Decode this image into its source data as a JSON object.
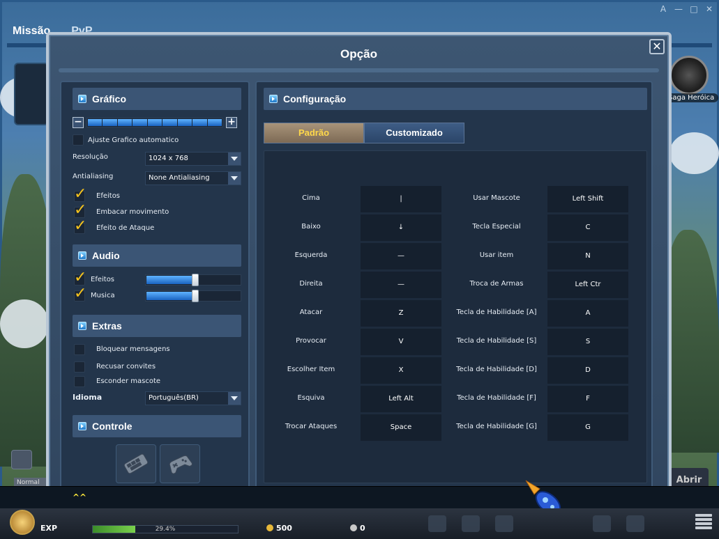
{
  "window_controls": [
    "A",
    "—",
    "□",
    "✕"
  ],
  "background": {
    "tabs": [
      "Missão",
      "PvP"
    ],
    "hero_label": "Saga Heróica",
    "normal_tag": "Normal",
    "open_button": "Abrir"
  },
  "modal": {
    "title": "Opção",
    "close_label": "✕"
  },
  "graphics": {
    "header": "Gráfico",
    "quality_level": 1.0,
    "auto_adjust_label": "Ajuste Grafico automatico",
    "auto_adjust_checked": false,
    "resolution_label": "Resolução",
    "resolution_value": "1024 x 768",
    "antialiasing_label": "Antialiasing",
    "antialiasing_value": "None Antialiasing",
    "effects_label": "Efeitos",
    "effects_checked": true,
    "motion_blur_label": "Embacar movimento",
    "motion_blur_checked": true,
    "attack_effect_label": "Efeito de Ataque",
    "attack_effect_checked": true
  },
  "audio": {
    "header": "Audio",
    "effects_label": "Efeitos",
    "effects_checked": true,
    "effects_level": 0.53,
    "music_label": "Musica",
    "music_checked": true,
    "music_level": 0.53
  },
  "extras": {
    "header": "Extras",
    "block_messages_label": "Bloquear mensagens",
    "refuse_invites_label": "Recusar convites",
    "hide_pet_label": "Esconder mascote",
    "language_label": "Idioma",
    "language_value": "Português(BR)"
  },
  "control": {
    "header": "Controle",
    "keyboard_icon": "keyboard-icon",
    "gamepad_icon": "gamepad-icon"
  },
  "config": {
    "header": "Configuração",
    "tabs": [
      {
        "label": "Padrão",
        "active": true
      },
      {
        "label": "Customizado",
        "active": false
      }
    ],
    "left_keys": [
      {
        "action": "Cima",
        "key": "|"
      },
      {
        "action": "Baixo",
        "key": "↓"
      },
      {
        "action": "Esquerda",
        "key": "—"
      },
      {
        "action": "Direita",
        "key": "—"
      },
      {
        "action": "Atacar",
        "key": "Z"
      },
      {
        "action": "Provocar",
        "key": "V"
      },
      {
        "action": "Escolher Item",
        "key": "X"
      },
      {
        "action": "Esquiva",
        "key": "Left Alt"
      },
      {
        "action": "Trocar Ataques",
        "key": "Space"
      }
    ],
    "right_keys": [
      {
        "action": "Usar Mascote",
        "key": "Left Shift"
      },
      {
        "action": "Tecla Especial",
        "key": "C"
      },
      {
        "action": "Usar item",
        "key": "N"
      },
      {
        "action": "Troca de Armas",
        "key": "Left Ctr"
      },
      {
        "action": "Tecla de Habilidade [A]",
        "key": "A"
      },
      {
        "action": "Tecla de Habilidade [S]",
        "key": "S"
      },
      {
        "action": "Tecla de Habilidade [D]",
        "key": "D"
      },
      {
        "action": "Tecla de Habilidade [F]",
        "key": "F"
      },
      {
        "action": "Tecla de Habilidade [G]",
        "key": "G"
      }
    ]
  },
  "chat": {
    "text": "^^"
  },
  "hud": {
    "exp_label": "EXP",
    "exp_percent_text": "29.4%",
    "exp_fraction": 0.294,
    "gold": "500",
    "cash": "0"
  },
  "colors": {
    "accent_yellow": "#f5c31d",
    "tab_active_text": "#ffd84a",
    "panel_bg": "#23354b"
  }
}
